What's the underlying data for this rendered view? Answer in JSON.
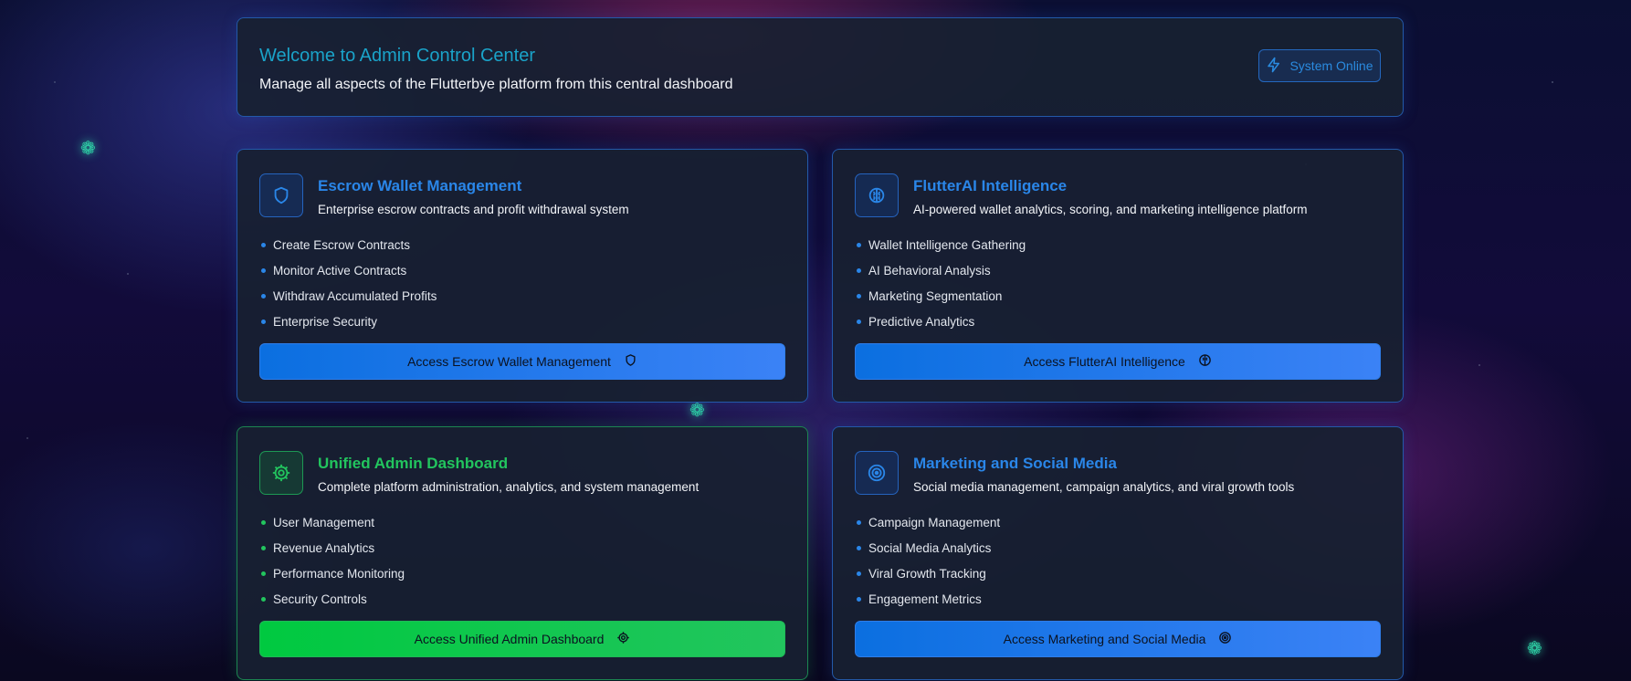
{
  "welcome": {
    "title": "Welcome to Admin Control Center",
    "subtitle": "Manage all aspects of the Flutterbye platform from this central dashboard",
    "status_label": "System Online",
    "status_icon": "lightning-icon"
  },
  "colors": {
    "accent_blue": "#2a86e8",
    "accent_green": "#22c55e",
    "welcome_title": "#1aa3c9"
  },
  "cards": [
    {
      "title": "Escrow Wallet Management",
      "description": "Enterprise escrow contracts and profit withdrawal system",
      "icon": "shield-icon",
      "features": [
        "Create Escrow Contracts",
        "Monitor Active Contracts",
        "Withdraw Accumulated Profits",
        "Enterprise Security"
      ],
      "button_label": "Access Escrow Wallet Management"
    },
    {
      "title": "FlutterAI Intelligence",
      "description": "AI-powered wallet analytics, scoring, and marketing intelligence platform",
      "icon": "brain-icon",
      "features": [
        "Wallet Intelligence Gathering",
        "AI Behavioral Analysis",
        "Marketing Segmentation",
        "Predictive Analytics"
      ],
      "button_label": "Access FlutterAI Intelligence"
    },
    {
      "title": "Unified Admin Dashboard",
      "description": "Complete platform administration, analytics, and system management",
      "icon": "gear-icon",
      "features": [
        "User Management",
        "Revenue Analytics",
        "Performance Monitoring",
        "Security Controls"
      ],
      "button_label": "Access Unified Admin Dashboard"
    },
    {
      "title": "Marketing and Social Media",
      "description": "Social media management, campaign analytics, and viral growth tools",
      "icon": "target-icon",
      "features": [
        "Campaign Management",
        "Social Media Analytics",
        "Viral Growth Tracking",
        "Engagement Metrics"
      ],
      "button_label": "Access Marketing and Social Media"
    }
  ]
}
